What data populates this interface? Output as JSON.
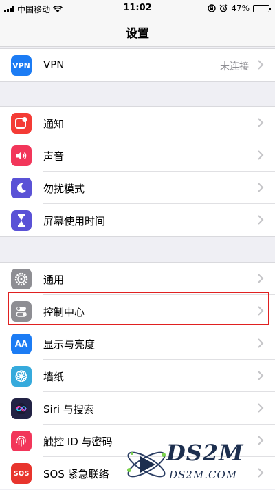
{
  "status_bar": {
    "carrier": "中国移动",
    "time": "11:02",
    "battery_percent": "47%",
    "battery_level": 0.47
  },
  "nav": {
    "title": "设置"
  },
  "rows": [
    {
      "label": "VPN",
      "value": "未连接",
      "icon": "vpn-icon",
      "color": "#1c7cf4"
    },
    {
      "label": "通知",
      "icon": "notifications-icon",
      "color": "#f43b35"
    },
    {
      "label": "声音",
      "icon": "sounds-icon",
      "color": "#f2365a"
    },
    {
      "label": "勿扰模式",
      "icon": "do-not-disturb-icon",
      "color": "#5a52d6"
    },
    {
      "label": "屏幕使用时间",
      "icon": "screen-time-icon",
      "color": "#5a52d6"
    },
    {
      "label": "通用",
      "icon": "gear-icon",
      "color": "#8e8e93"
    },
    {
      "label": "控制中心",
      "icon": "control-center-icon",
      "color": "#8e8e93"
    },
    {
      "label": "显示与亮度",
      "icon": "display-brightness-icon",
      "color": "#1c7cf4"
    },
    {
      "label": "墙纸",
      "icon": "wallpaper-icon",
      "color": "#36aadc"
    },
    {
      "label": "Siri 与搜索",
      "icon": "siri-icon",
      "color": "#222244"
    },
    {
      "label": "触控 ID 与密码",
      "icon": "fingerprint-icon",
      "color": "#f2365a"
    },
    {
      "label": "SOS 紧急联络",
      "icon": "sos-icon",
      "color": "#e8352d",
      "icon_text": "SOS"
    }
  ],
  "vpn_icon_text": "VPN",
  "display_icon_text": "AA",
  "watermark": {
    "brand": "DS2M",
    "domain": "DS2M.COM"
  }
}
